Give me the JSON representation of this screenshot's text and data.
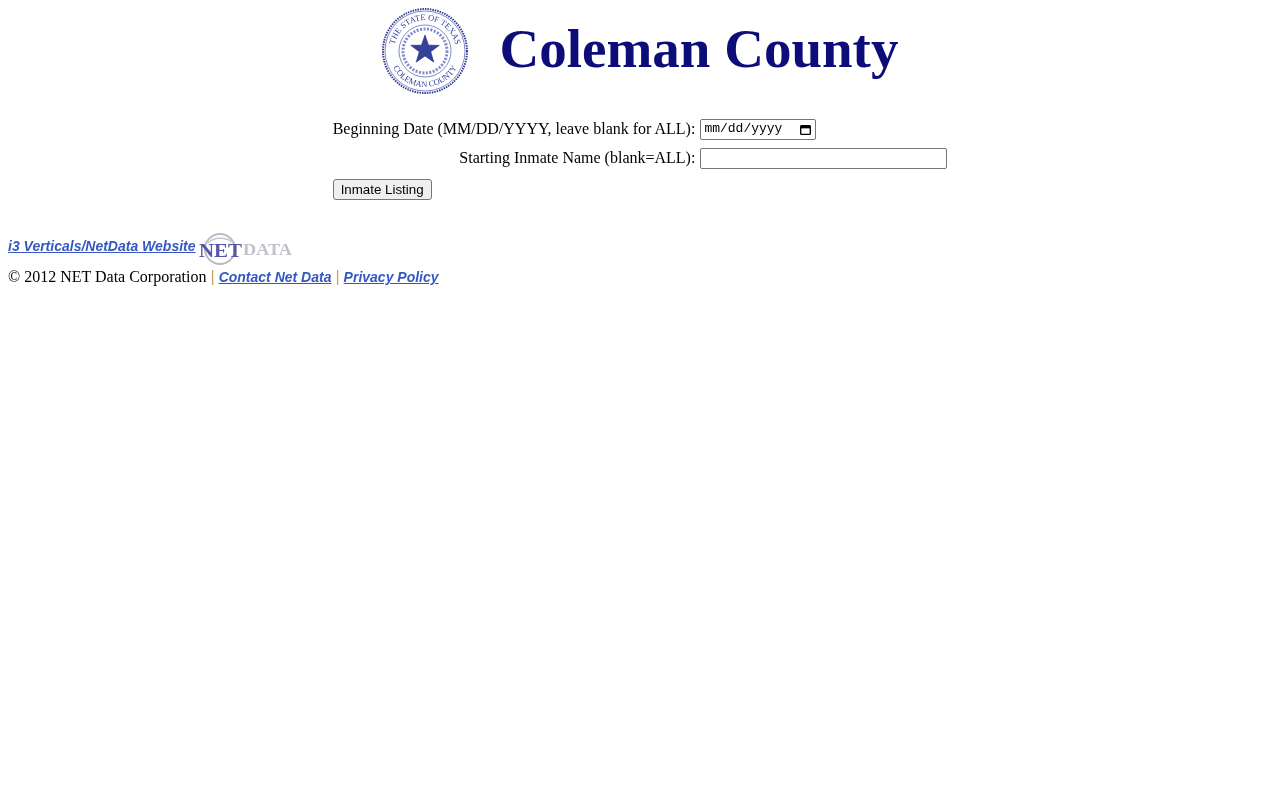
{
  "header": {
    "seal": {
      "top_text": "THE STATE OF TEXAS",
      "bottom_text": "COLEMAN COUNTY"
    },
    "title": "Coleman County"
  },
  "form": {
    "fields": [
      {
        "kind": "date",
        "label": "Beginning Date (MM/DD/YYYY, leave blank for ALL):",
        "placeholder": "mm/dd/yyyy"
      },
      {
        "kind": "text",
        "label": "Starting Inmate Name (blank=ALL):"
      }
    ],
    "submit": "Inmate Listing"
  },
  "footer": {
    "website_link": "i3 Verticals/NetData Website",
    "logo": {
      "primary": "NET",
      "secondary": "DATA"
    },
    "items": [
      {
        "kind": "text",
        "text": "© 2012 NET Data Corporation"
      },
      {
        "kind": "separator",
        "text": "|"
      },
      {
        "kind": "link",
        "text": "Contact Net Data"
      },
      {
        "kind": "separator",
        "text": "|"
      },
      {
        "kind": "link",
        "text": "Privacy Policy"
      }
    ]
  }
}
